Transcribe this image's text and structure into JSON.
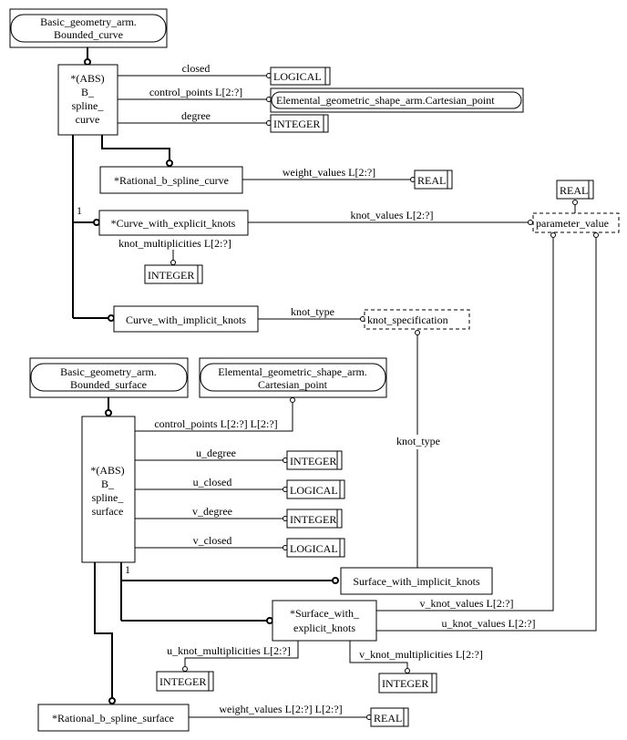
{
  "diagram": {
    "entities": {
      "bounded_curve": [
        "Basic_geometry_arm.",
        "Bounded_curve"
      ],
      "b_spline_curve": [
        "*(ABS)",
        "B_",
        "spline_",
        "curve"
      ],
      "rational_b_spline_curve": "*Rational_b_spline_curve",
      "curve_with_explicit_knots": "*Curve_with_explicit_knots",
      "curve_with_implicit_knots": "Curve_with_implicit_knots",
      "bounded_surface": [
        "Basic_geometry_arm.",
        "Bounded_surface"
      ],
      "cartesian_point_ref": [
        "Elemental_geometric_shape_arm.",
        "Cartesian_point"
      ],
      "b_spline_surface": [
        "*(ABS)",
        "B_",
        "spline_",
        "surface"
      ],
      "surface_with_implicit_knots": "Surface_with_implicit_knots",
      "surface_with_explicit_knots": [
        "*Surface_with_",
        "explicit_knots"
      ],
      "rational_b_spline_surface": "*Rational_b_spline_surface"
    },
    "types": {
      "logical": "LOGICAL",
      "integer": "INTEGER",
      "real": "REAL",
      "cartesian_point_inline": "Elemental_geometric_shape_arm.Cartesian_point",
      "parameter_value": "parameter_value",
      "knot_specification": "knot_specification"
    },
    "attributes": {
      "closed": "closed",
      "control_points_curve": "control_points L[2:?]",
      "degree": "degree",
      "weight_values_curve": "weight_values L[2:?]",
      "knot_values": "knot_values L[2:?]",
      "knot_multiplicities": "knot_multiplicities L[2:?]",
      "knot_type_curve": "knot_type",
      "knot_type_surface": "knot_type",
      "control_points_surface": "control_points L[2:?] L[2:?]",
      "u_degree": "u_degree",
      "u_closed": "u_closed",
      "v_degree": "v_degree",
      "v_closed": "v_closed",
      "v_knot_values": "v_knot_values L[2:?]",
      "u_knot_values": "u_knot_values L[2:?]",
      "u_knot_multiplicities": "u_knot_multiplicities L[2:?]",
      "v_knot_multiplicities": "v_knot_multiplicities L[2:?]",
      "weight_values_surface": "weight_values L[2:?] L[2:?]"
    },
    "cardinality_labels": {
      "curve_one_of": "1",
      "surface_one_of": "1"
    }
  }
}
